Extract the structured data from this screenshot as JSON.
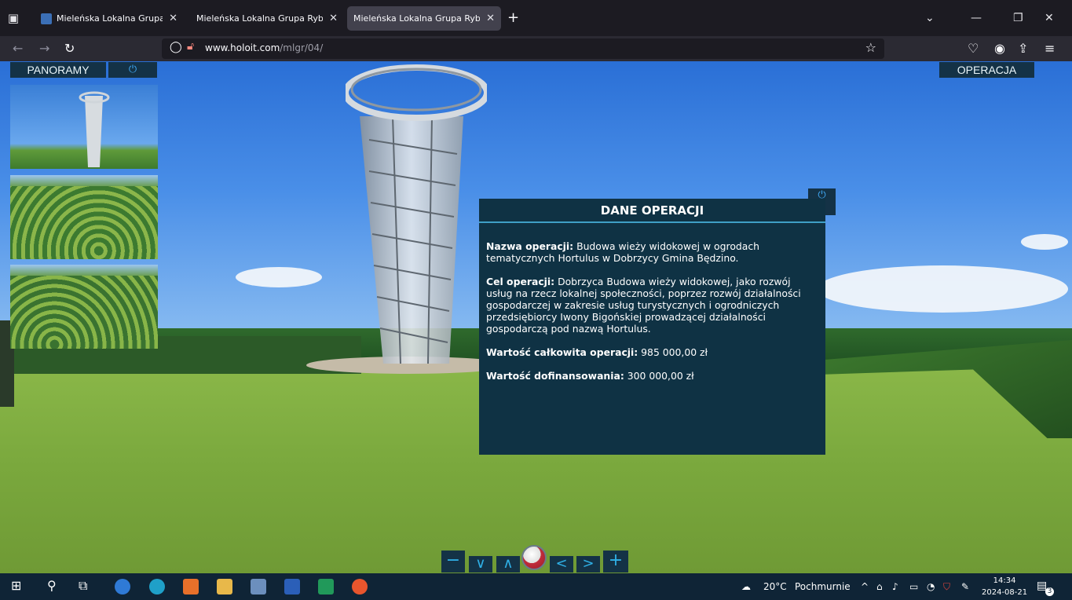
{
  "browser": {
    "tabs": [
      {
        "title": "Mieleńska Lokalna Grupa Rybac",
        "active": false
      },
      {
        "title": "Mieleńska Lokalna Grupa Rybacka",
        "active": false
      },
      {
        "title": "Mieleńska Lokalna Grupa Rybacka",
        "active": true
      }
    ],
    "close_glyph": "✕",
    "new_tab_glyph": "+",
    "url_domain": "www.holoit.com",
    "url_path": "/mlgr/04/"
  },
  "panorama_menu": {
    "title": "PANORAMY",
    "power_glyph": "⏻"
  },
  "operation_button": "OPERACJA",
  "dialog": {
    "title": "DANE OPERACJI",
    "power_glyph": "⏻",
    "name_label": "Nazwa operacji:",
    "name_value": " Budowa wieży widokowej w ogrodach tematycznych Hortulus w Dobrzycy Gmina Będzino.",
    "goal_label": "Cel operacji:",
    "goal_value": " Dobrzyca Budowa wieży widokowej, jako rozwój usług na rzecz lokalnej społeczności, poprzez rozwój działalności gospodarczej w zakresie usług turystycznych i ogrodniczych przedsiębiorcy Iwony Bigońskiej prowadzącej działalności gospodarczą pod nazwą Hortulus.",
    "total_label": "Wartość całkowita operacji:",
    "total_value": " 985 000,00 zł",
    "funding_label": "Wartość dofinansowania:",
    "funding_value": " 300 000,00 zł"
  },
  "controls": {
    "zoom_out": "−",
    "down": "∨",
    "up": "∧",
    "left": "<",
    "right": ">",
    "zoom_in": "+"
  },
  "taskbar": {
    "weather_temp": "20°C",
    "weather_text": "Pochmurnie",
    "time": "14:34",
    "date": "2024-08-21",
    "notifications": "3"
  },
  "colors": {
    "panel": "#143246",
    "dialog_bg": "#0f3244",
    "accent": "#2fb0e6"
  }
}
